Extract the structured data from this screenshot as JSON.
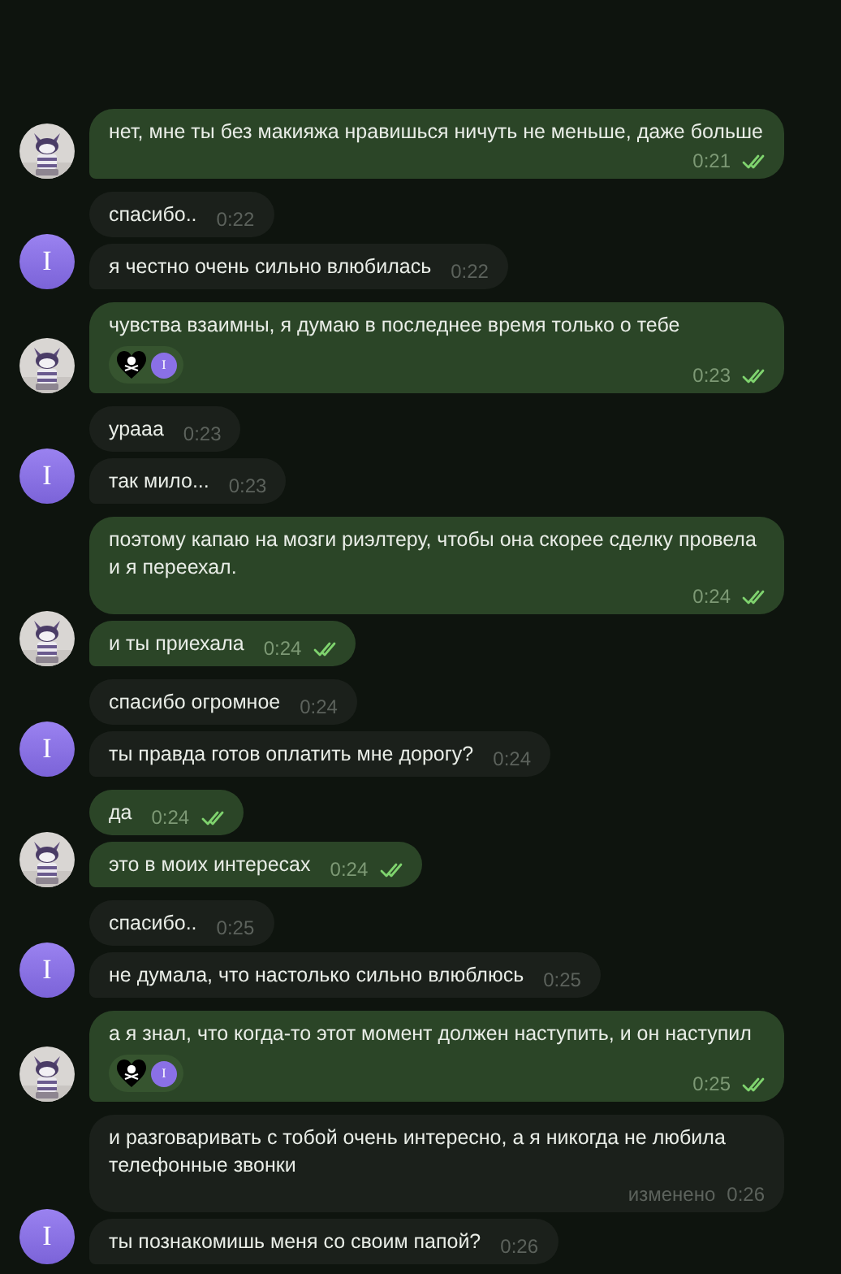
{
  "groups": [
    {
      "kind": "outgoing",
      "avatar": {
        "kind": "picture"
      },
      "messages": [
        {
          "text": "нет, мне ты без макияжа нравишься ничуть не меньше, даже больше",
          "time": "0:21",
          "read": true
        }
      ]
    },
    {
      "kind": "incoming",
      "avatar": {
        "kind": "letter",
        "letter": "I"
      },
      "messages": [
        {
          "text": "спасибо..",
          "time": "0:22"
        },
        {
          "text": "я честно очень сильно влюбилась",
          "time": "0:22"
        }
      ]
    },
    {
      "kind": "outgoing",
      "avatar": {
        "kind": "picture"
      },
      "messages": [
        {
          "text": "чувства взаимны, я думаю в последнее время только о тебе",
          "time": "0:23",
          "read": true,
          "reactions": [
            {
              "kind": "heart-skull"
            },
            {
              "kind": "avatar",
              "letter": "I"
            }
          ]
        }
      ]
    },
    {
      "kind": "incoming",
      "avatar": {
        "kind": "letter",
        "letter": "I"
      },
      "messages": [
        {
          "text": "урааа",
          "time": "0:23"
        },
        {
          "text": "так мило...",
          "time": "0:23"
        }
      ]
    },
    {
      "kind": "outgoing",
      "avatar": {
        "kind": "picture"
      },
      "messages": [
        {
          "text": "поэтому капаю на мозги риэлтеру, чтобы она скорее сделку провела и я переехал.",
          "time": "0:24",
          "read": true
        },
        {
          "text": "и ты приехала",
          "time": "0:24",
          "read": true
        }
      ]
    },
    {
      "kind": "incoming",
      "avatar": {
        "kind": "letter",
        "letter": "I"
      },
      "messages": [
        {
          "text": "спасибо огромное",
          "time": "0:24"
        },
        {
          "text": "ты правда готов оплатить мне дорогу?",
          "time": "0:24"
        }
      ]
    },
    {
      "kind": "outgoing",
      "avatar": {
        "kind": "picture"
      },
      "messages": [
        {
          "text": "да",
          "time": "0:24",
          "read": true
        },
        {
          "text": "это в моих интересах",
          "time": "0:24",
          "read": true
        }
      ]
    },
    {
      "kind": "incoming",
      "avatar": {
        "kind": "letter",
        "letter": "I"
      },
      "messages": [
        {
          "text": "спасибо..",
          "time": "0:25"
        },
        {
          "text": "не думала, что настолько сильно влюблюсь",
          "time": "0:25"
        }
      ]
    },
    {
      "kind": "outgoing",
      "avatar": {
        "kind": "picture"
      },
      "messages": [
        {
          "text": "а я знал, что когда-то этот момент должен наступить, и он наступил",
          "time": "0:25",
          "read": true,
          "reactions": [
            {
              "kind": "heart-skull"
            },
            {
              "kind": "avatar",
              "letter": "I"
            }
          ]
        }
      ]
    },
    {
      "kind": "incoming",
      "avatar": {
        "kind": "letter",
        "letter": "I"
      },
      "messages": [
        {
          "text": "и разговаривать с тобой очень интересно, а я никогда не любила телефонные звонки",
          "edited": "изменено",
          "time": "0:26"
        },
        {
          "text": "ты познакомишь меня со своим папой?",
          "time": "0:26"
        }
      ]
    }
  ]
}
